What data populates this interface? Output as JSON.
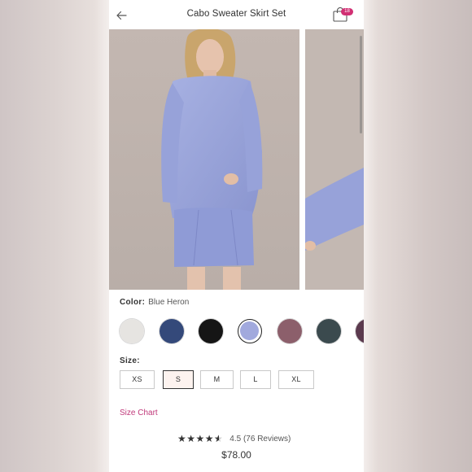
{
  "header": {
    "title": "Cabo Sweater Skirt Set",
    "back_icon": "arrow-left-icon",
    "bag_icon": "shopping-bag-icon",
    "bag_count": "18"
  },
  "colors": {
    "accent": "#c0397a",
    "badge": "#d12f73",
    "product": "#9aa6da"
  },
  "color_picker": {
    "label": "Color:",
    "selected": "Blue Heron",
    "swatches": [
      {
        "name": "cream",
        "hex": "#e6e4e1"
      },
      {
        "name": "navy",
        "hex": "#34497a"
      },
      {
        "name": "black",
        "hex": "#151515"
      },
      {
        "name": "blue-heron",
        "hex": "#a1a9dd"
      },
      {
        "name": "mauve",
        "hex": "#8c5f6b"
      },
      {
        "name": "slate",
        "hex": "#3b4a4e"
      },
      {
        "name": "plum",
        "hex": "#5b3a4e"
      }
    ]
  },
  "size_picker": {
    "label": "Size:",
    "options": [
      "XS",
      "S",
      "M",
      "L",
      "XL"
    ],
    "selected": "S"
  },
  "size_chart_link": "Size Chart",
  "reviews": {
    "rating": 4.5,
    "text": "4.5 (76 Reviews)"
  },
  "price": "$78.00"
}
